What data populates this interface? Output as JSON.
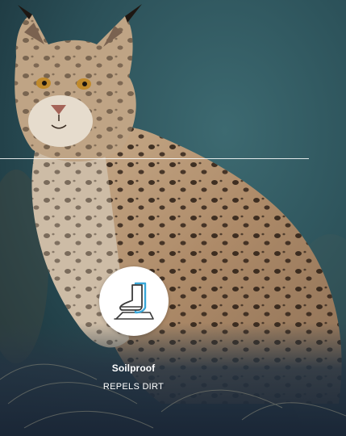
{
  "feature": {
    "icon": "soilproof-boot-icon",
    "title": "Soilproof",
    "subtitle": "REPELS DIRT"
  },
  "colors": {
    "background_teal": "#2d5860",
    "fur_base": "#b89a7a",
    "icon_accent": "#3aa7d8",
    "icon_outline": "#3b3b3b",
    "text": "#ffffff"
  }
}
